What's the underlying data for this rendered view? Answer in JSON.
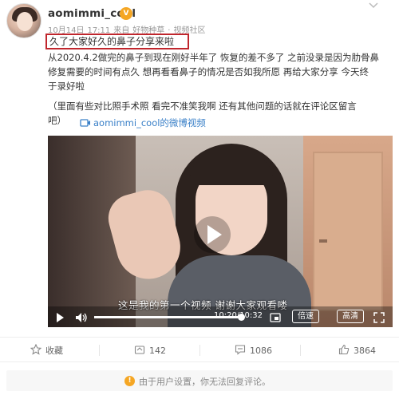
{
  "post": {
    "username": "aomimmi_cool",
    "badge_glyph": "V",
    "meta": {
      "date": "10月14日",
      "time": "17:11",
      "source": "来自",
      "category": "好物种草",
      "separator": "·",
      "community": "视频社区"
    },
    "highlighted_title": "久了大家好久的鼻子分享来啦",
    "body_lines": [
      "从2020.4.2做完的鼻子到现在刚好半年了 恢复的差不多了 之前没录是因为肋骨鼻",
      "修复需要的时间有点久 想再看看鼻子的情况是否如我所愿 再给大家分享 今天终",
      "于录好啦"
    ],
    "note_lines": [
      "（里面有些对比照手术照 看完不准笑我啊 还有其他问题的话就在评论区留言",
      "吧）"
    ],
    "video_link_text": "aomimmi_cool的微博视频"
  },
  "video": {
    "subtitle": "这是我的第一个视频 谢谢大家观看喽",
    "current_time": "10:20",
    "total_time": "10:32",
    "time_display": "10:20/10:32",
    "progress": 0.98,
    "speed_label": "倍速",
    "quality_label": "高清"
  },
  "actions": {
    "favorite_label": "收藏",
    "repost_count": "142",
    "comment_count": "1086",
    "like_count": "3864"
  },
  "notice": {
    "icon_glyph": "!",
    "text": "由于用户设置，你无法回复评论。"
  },
  "colors": {
    "highlight_border": "#c0262d",
    "link": "#3a80c8",
    "badge": "#f5a623"
  },
  "icons": [
    "more-icon",
    "link-video-icon",
    "play-icon",
    "volume-icon",
    "pip-icon",
    "fullscreen-icon",
    "star-icon",
    "repost-icon",
    "comment-icon",
    "like-icon",
    "warning-icon"
  ]
}
